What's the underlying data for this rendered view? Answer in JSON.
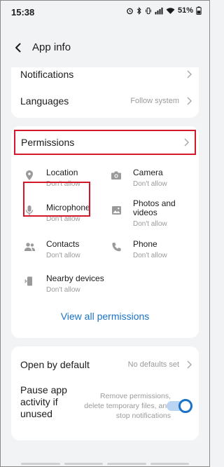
{
  "status_bar": {
    "time": "15:38",
    "battery": "51%"
  },
  "header": {
    "title": "App info"
  },
  "settings_top": {
    "notifications_label": "Notifications",
    "languages_label": "Languages",
    "languages_value": "Follow system"
  },
  "permissions": {
    "title": "Permissions",
    "items": [
      {
        "name": "Location",
        "status": "Don't allow",
        "icon": "location-icon"
      },
      {
        "name": "Camera",
        "status": "Don't allow",
        "icon": "camera-icon"
      },
      {
        "name": "Microphone",
        "status": "Don't allow",
        "icon": "microphone-icon"
      },
      {
        "name": "Photos and videos",
        "status": "Don't allow",
        "icon": "photo-icon"
      },
      {
        "name": "Contacts",
        "status": "Don't allow",
        "icon": "contacts-icon"
      },
      {
        "name": "Phone",
        "status": "Don't allow",
        "icon": "phone-icon"
      },
      {
        "name": "Nearby devices",
        "status": "Don't allow",
        "icon": "nearby-devices-icon"
      }
    ],
    "view_all_label": "View all permissions"
  },
  "open_by_default": {
    "label": "Open by default",
    "value": "No defaults set"
  },
  "pause_activity": {
    "label": "Pause app activity if unused",
    "description": "Remove permissions, delete temporary files, and stop notifications",
    "enabled": true
  },
  "colors": {
    "accent": "#1a73c7",
    "highlight": "#d3182c",
    "background": "#f2f3f5",
    "card": "#ffffff"
  }
}
